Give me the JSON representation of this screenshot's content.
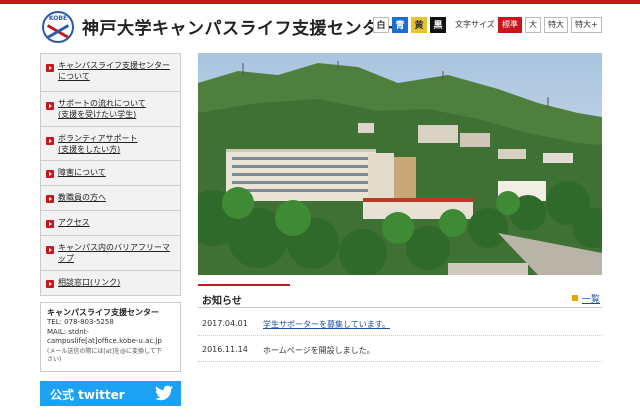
{
  "header": {
    "logo_text": "KOBE",
    "site_title": "神戸大学キャンパスライフ支援センター",
    "color_buttons": [
      "白",
      "青",
      "黄",
      "黒"
    ],
    "font_size_label": "文字サイズ",
    "font_size_buttons": [
      "標準",
      "大",
      "特大",
      "特大+"
    ]
  },
  "colors": {
    "accent_red": "#c8161d",
    "link_blue": "#1a4fa0",
    "twitter_blue": "#1da1f2"
  },
  "nav": {
    "items": [
      {
        "label": "キャンパスライフ支援センター\nについて"
      },
      {
        "label": "サポートの流れについて\n(支援を受けたい学生)"
      },
      {
        "label": "ボランティアサポート\n(支援をしたい方)"
      },
      {
        "label": "障害について"
      },
      {
        "label": "教職員の方へ"
      },
      {
        "label": "アクセス"
      },
      {
        "label": "キャンパス内のバリアフリーマ\nップ"
      },
      {
        "label": "相談窓口(リンク)"
      }
    ]
  },
  "contact": {
    "name": "キャンパスライフ支援センター",
    "tel": "TEL: 078-803-5258",
    "mail": "MAIL: stdnt-\ncampuslife[at]office.kobe-u.ac.jp",
    "note": "(メール送信の際には[at]を@に変換して下\nさい)"
  },
  "twitter": {
    "label": "公式 twitter",
    "icon": "twitter-bird-icon"
  },
  "news": {
    "title": "お知らせ",
    "more_label": "一覧",
    "items": [
      {
        "date": "2017.04.01",
        "text": "学生サポーターを募集しています。",
        "link": true
      },
      {
        "date": "2016.11.14",
        "text": "ホームページを開設しました。",
        "link": false
      }
    ]
  }
}
